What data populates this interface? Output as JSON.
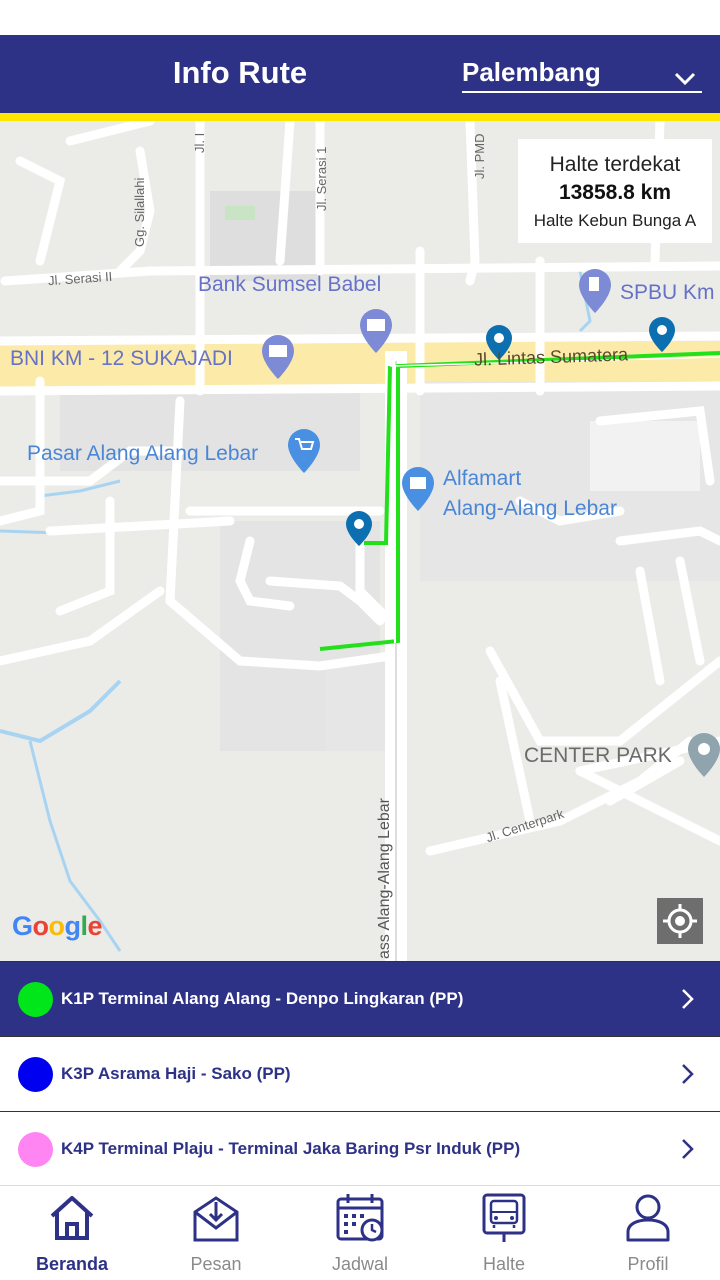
{
  "header": {
    "title": "Info Rute",
    "city_selected": "Palembang"
  },
  "map": {
    "nearest": {
      "title": "Halte terdekat",
      "distance": "13858.8 km",
      "stop_name": "Halte Kebun Bunga A"
    },
    "labels": {
      "bank": "Bank Sumsel Babel",
      "spbu": "SPBU Km",
      "bni": "BNI KM - 12 SUKAJADI",
      "lintas": "Jl. Lintas Sumatera",
      "pasar": "Pasar Alang Alang Lebar",
      "alfamart_1": "Alfamart",
      "alfamart_2": "Alang-Alang Lebar",
      "center_park": "CENTER PARK",
      "centerpark_road": "Jl. Centerpark",
      "bypass": "ass Alang-Alang Lebar",
      "serasi_2": "Jl. Serasi II",
      "serasi_1": "Jl. Serasi 1",
      "sialahi": "Gg. Silallahi",
      "pmd": "Jl. PMD",
      "jl_short": "Jl. I",
      "google": "Google"
    },
    "route_color": "#22e01a"
  },
  "routes": [
    {
      "label": "K1P Terminal Alang Alang - Denpo Lingkaran (PP)",
      "color": "#00e61b",
      "active": true
    },
    {
      "label": "K3P Asrama Haji - Sako (PP)",
      "color": "#0000f0",
      "active": false
    },
    {
      "label": "K4P Terminal Plaju - Terminal Jaka Baring Psr Induk (PP)",
      "color": "#ff85f2",
      "active": false
    }
  ],
  "nav": [
    {
      "label": "Beranda",
      "icon": "home-icon",
      "active": true
    },
    {
      "label": "Pesan",
      "icon": "mail-download-icon",
      "active": false
    },
    {
      "label": "Jadwal",
      "icon": "calendar-clock-icon",
      "active": false
    },
    {
      "label": "Halte",
      "icon": "bus-stop-icon",
      "active": false
    },
    {
      "label": "Profil",
      "icon": "user-icon",
      "active": false
    }
  ],
  "colors": {
    "primary": "#2e3287",
    "accent_yellow": "#ffe600",
    "inactive_nav": "#8a8a8a"
  }
}
